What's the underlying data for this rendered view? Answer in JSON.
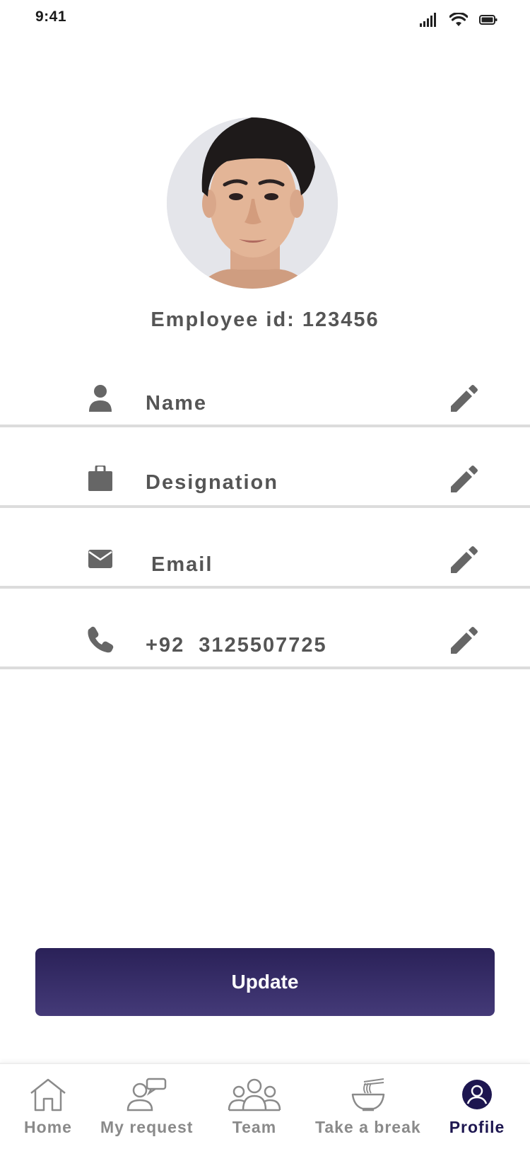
{
  "status_bar": {
    "time": "9:41"
  },
  "profile": {
    "avatar_icon": "person-photo",
    "employee_id_label": "Employee id: 123456"
  },
  "fields": [
    {
      "icon": "person-icon",
      "label": "Name"
    },
    {
      "icon": "briefcase-icon",
      "label": "Designation"
    },
    {
      "icon": "mail-icon",
      "label": "Email"
    },
    {
      "icon": "phone-icon",
      "label": "+92  3125507725"
    }
  ],
  "update_button": {
    "label": "Update"
  },
  "tabs": [
    {
      "label": "Home",
      "icon": "home-icon",
      "active": false
    },
    {
      "label": "My request",
      "icon": "request-icon",
      "active": false
    },
    {
      "label": "Team",
      "icon": "team-icon",
      "active": false
    },
    {
      "label": "Take a break",
      "icon": "noodle-bowl-icon",
      "active": false
    },
    {
      "label": "Profile",
      "icon": "profile-icon",
      "active": true
    }
  ],
  "colors": {
    "primary": "#2a2158",
    "primary_light": "#443a78",
    "text_gray": "#555555",
    "icon_gray": "#666666",
    "divider": "#dcdcdc",
    "tab_inactive": "#8a8a8a",
    "tab_active": "#1d1650"
  }
}
